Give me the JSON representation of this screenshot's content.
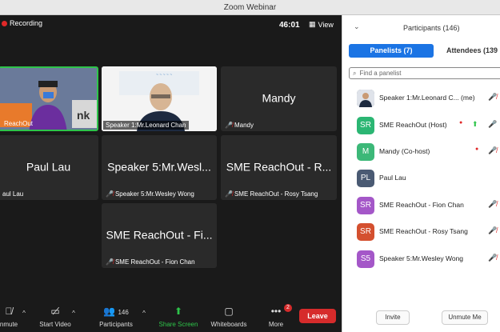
{
  "window": {
    "title": "Zoom Webinar"
  },
  "stage": {
    "recording_label": "Recording",
    "timer": "46:01",
    "view_label": "View",
    "tiles": [
      {
        "big": "",
        "caption": "ReachOut"
      },
      {
        "big": "",
        "caption": "Speaker 1:Mr.Leonard Chan"
      },
      {
        "big": "Mandy",
        "caption": "Mandy"
      },
      {
        "big": "Paul Lau",
        "caption": "aul Lau"
      },
      {
        "big": "Speaker 5:Mr.Wesl...",
        "caption": "Speaker 5:Mr.Wesley Wong"
      },
      {
        "big": "SME ReachOut - R...",
        "caption": "SME ReachOut - Rosy Tsang"
      },
      {
        "big": "SME ReachOut - Fi...",
        "caption": "SME ReachOut - Fion Chan"
      }
    ]
  },
  "toolbar": {
    "unmute": "nmute",
    "start_video": "Start Video",
    "participants": "Participants",
    "participants_count": "146",
    "share_screen": "Share Screen",
    "whiteboards": "Whiteboards",
    "more": "More",
    "more_badge": "2",
    "leave": "Leave"
  },
  "panel": {
    "title": "Participants (146)",
    "tab_panelists": "Panelists (7)",
    "tab_attendees": "Attendees (139",
    "search_placeholder": "Find a panelist",
    "rows": [
      {
        "initials": "",
        "color": "#5a6a7a",
        "name": "Speaker 1:Mr.Leonard C...  (me)"
      },
      {
        "initials": "SR",
        "color": "#2bb673",
        "name": "SME ReachOut (Host)"
      },
      {
        "initials": "M",
        "color": "#3cb878",
        "name": "Mandy (Co-host)"
      },
      {
        "initials": "PL",
        "color": "#4a5a73",
        "name": "Paul Lau"
      },
      {
        "initials": "SR",
        "color": "#a457c8",
        "name": "SME ReachOut - Fion Chan"
      },
      {
        "initials": "SR",
        "color": "#d4502f",
        "name": "SME ReachOut - Rosy Tsang"
      },
      {
        "initials": "S5",
        "color": "#a457c8",
        "name": "Speaker 5:Mr.Wesley Wong"
      }
    ],
    "invite_label": "Invite",
    "unmute_me_label": "Unmute Me"
  }
}
